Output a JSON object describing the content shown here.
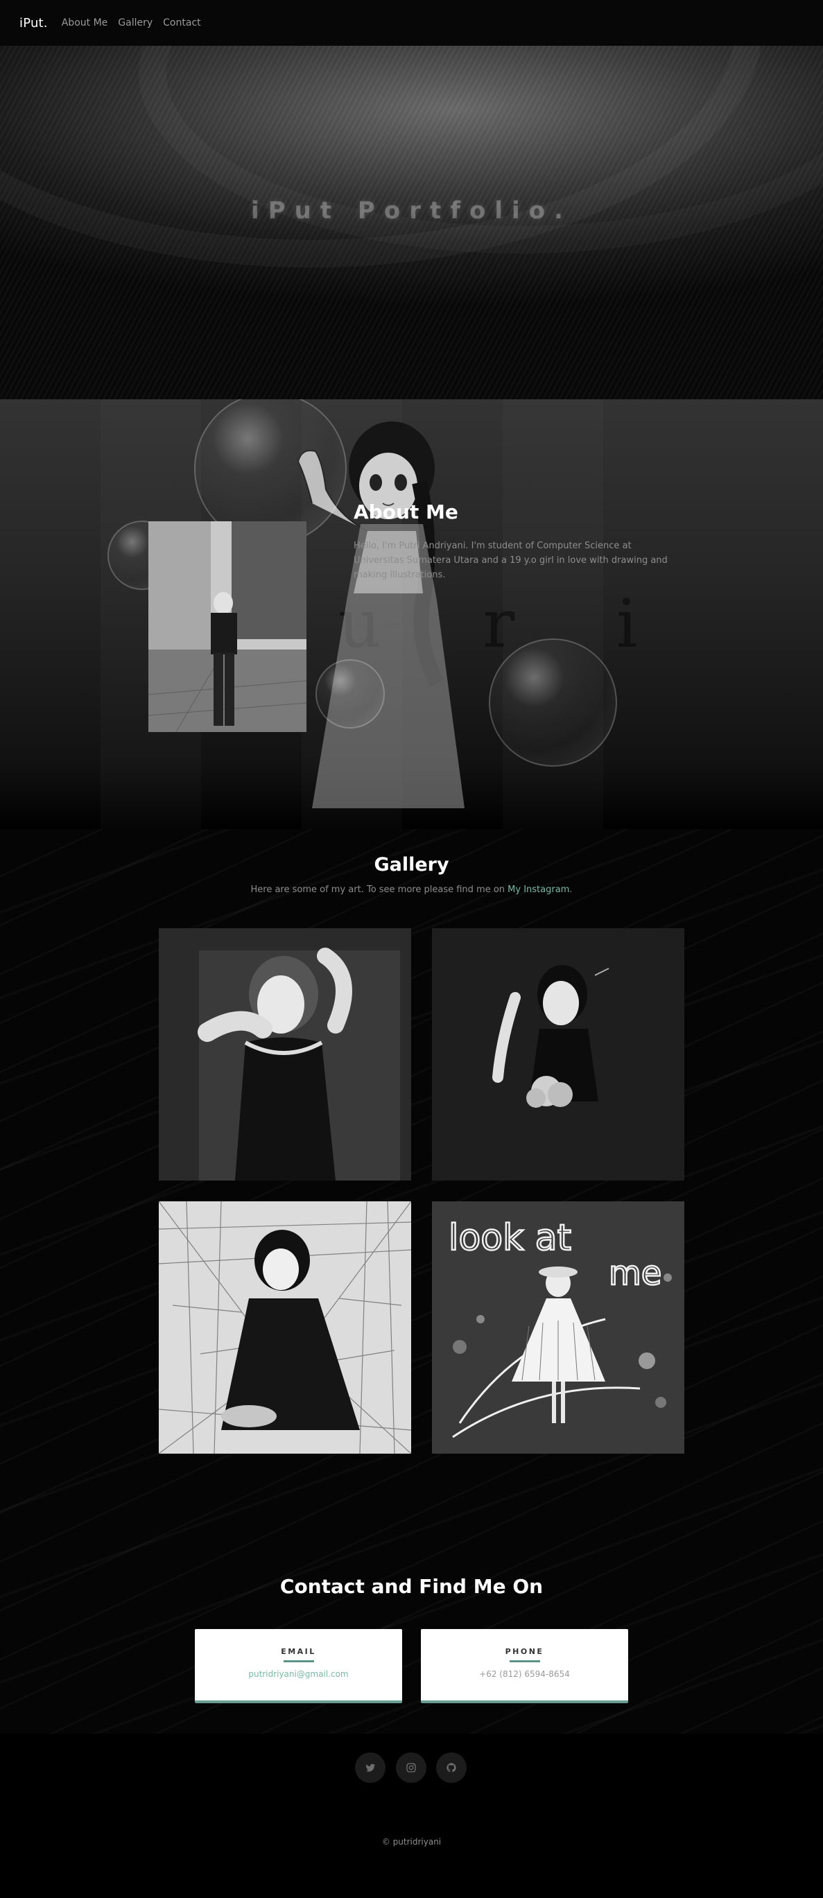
{
  "nav": {
    "brand": "iPut.",
    "links": [
      "About Me",
      "Gallery",
      "Contact"
    ]
  },
  "hero": {
    "title": "iPut Portfolio."
  },
  "about": {
    "title": "About Me",
    "body": "Hello, I'm Putri Andriyani. I'm student of Computer Science at Universitas Sumatera Utara and a 19 y.o girl in love with drawing and making illustrations.",
    "watermark": "u r i"
  },
  "gallery": {
    "title": "Gallery",
    "subtitle_prefix": "Here are some of my art. To see more please find me on ",
    "instagram_link": "My Instagram",
    "subtitle_suffix": ".",
    "tile4_text_top": "look at",
    "tile4_text_side": "me"
  },
  "contact": {
    "title": "Contact and Find Me On",
    "email_label": "EMAIL",
    "email_value": "putridriyani@gmail.com",
    "phone_label": "PHONE",
    "phone_value": "+62 (812) 6594-8654"
  },
  "social": [
    "twitter-icon",
    "instagram-icon",
    "github-icon"
  ],
  "footer": {
    "copyright": "© putridriyani"
  },
  "colors": {
    "accent": "#78b9a5",
    "card_border": "#6b9f94",
    "background": "#000000"
  }
}
